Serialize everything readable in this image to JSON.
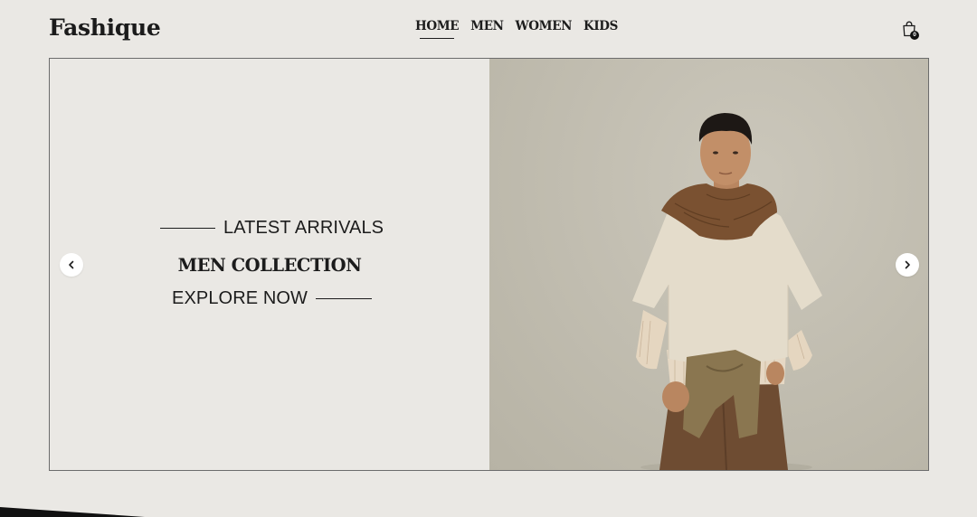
{
  "brand": {
    "name": "Fashique"
  },
  "nav": {
    "items": [
      {
        "label": "HOME",
        "active": true
      },
      {
        "label": "MEN",
        "active": false
      },
      {
        "label": "WOMEN",
        "active": false
      },
      {
        "label": "KIDS",
        "active": false
      }
    ]
  },
  "cart": {
    "icon": "shopping-bag-icon",
    "count": "0"
  },
  "hero": {
    "eyebrow": "LATEST ARRIVALS",
    "headline": "MEN COLLECTION",
    "cta": "EXPLORE NOW",
    "image": "model-photo",
    "prev_icon": "chevron-left-icon",
    "next_icon": "chevron-right-icon"
  },
  "colors": {
    "background": "#eae8e4",
    "text": "#1c1c1c",
    "hero_border": "#6c6c6c",
    "photo_backdrop": "#c2beb1"
  }
}
